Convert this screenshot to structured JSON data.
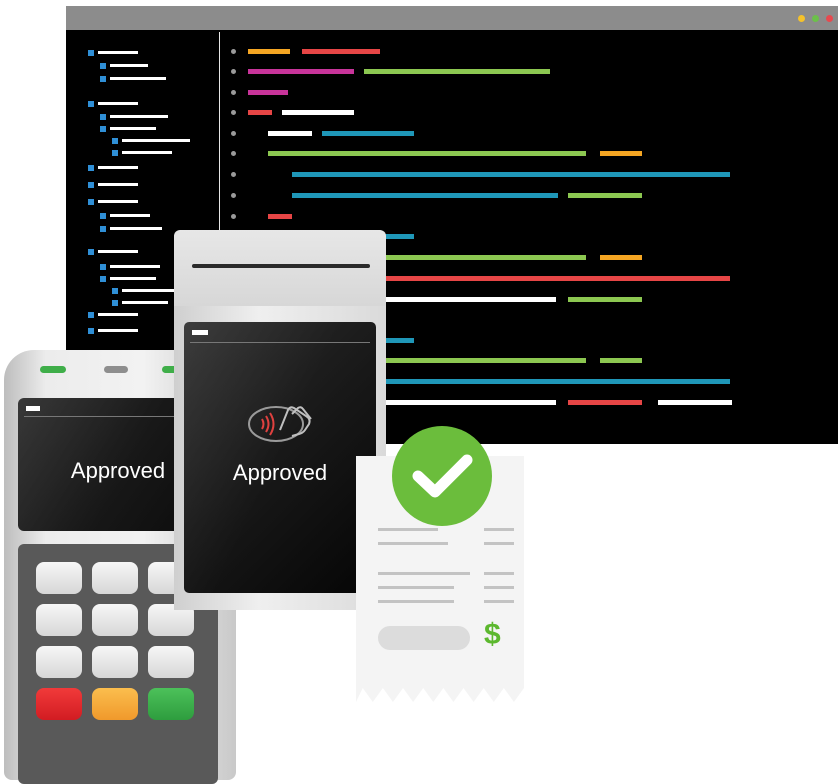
{
  "terminal_left": {
    "status_text": "Approved"
  },
  "pos_device": {
    "status_text": "Approved",
    "contactless_icon": "contactless-payment-icon"
  },
  "receipt": {
    "currency_symbol": "$",
    "checkmark_icon": "checkmark-icon"
  },
  "colors": {
    "editor_background": "#000000",
    "titlebar": "#8c8c8c",
    "code_orange": "#f5a623",
    "code_red": "#e64545",
    "code_magenta": "#c8349a",
    "code_green": "#8cc751",
    "code_blue": "#1f97b8",
    "code_white": "#ffffff",
    "tree_blue": "#2f8fd6",
    "check_green": "#6bbd3c",
    "dollar_green": "#5cb82e",
    "key_red": "#e5262e",
    "key_orange": "#f7a83a",
    "key_green": "#3aae49"
  }
}
